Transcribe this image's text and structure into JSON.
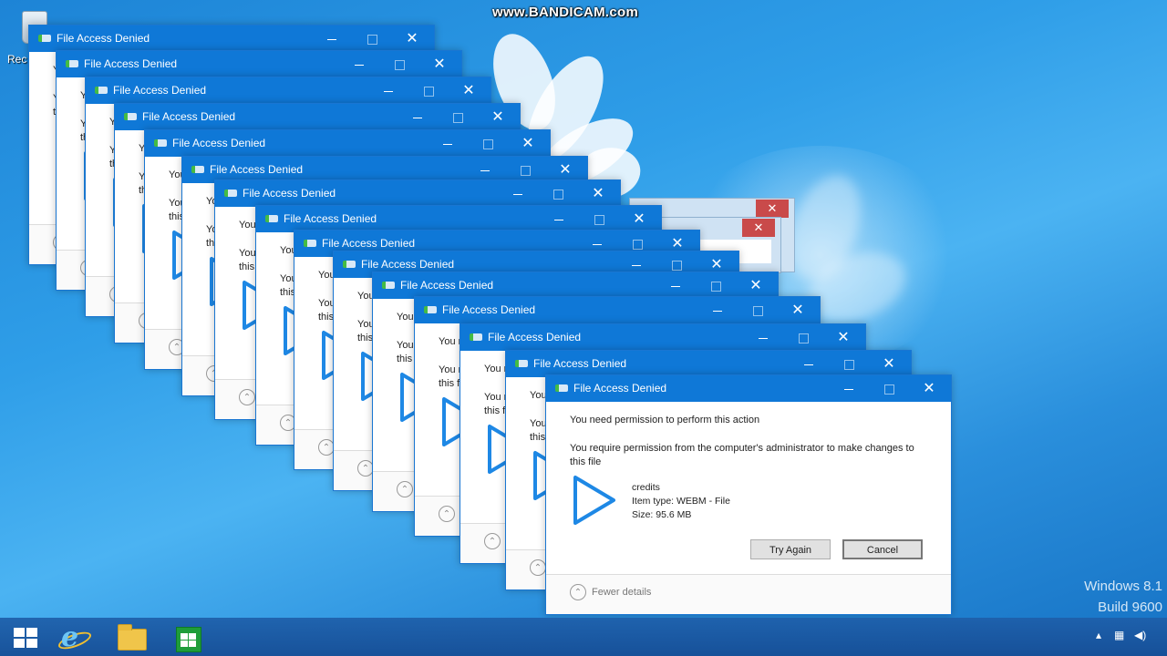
{
  "watermark": "www.BANDICAM.com",
  "desktop": {
    "recycle_bin_label": "Rec",
    "os_name": "Windows 8.1",
    "os_build": "Build 9600"
  },
  "dialog": {
    "title": "File Access Denied",
    "headline": "You need permission to perform this action",
    "description": "You require permission from the computer's administrator to make changes to this file",
    "file_name": "credits",
    "item_type": "Item type: WEBM - File",
    "size": "Size: 95.6 MB",
    "try_again": "Try Again",
    "cancel": "Cancel",
    "fewer_details": "Fewer details",
    "close_glyph": "✕"
  },
  "legacy_close_glyph": "✕",
  "taskbar": {
    "apps": [
      "start",
      "internet-explorer",
      "file-explorer",
      "store"
    ],
    "tray": [
      "chevron-up-icon",
      "network-icon",
      "volume-icon"
    ]
  }
}
